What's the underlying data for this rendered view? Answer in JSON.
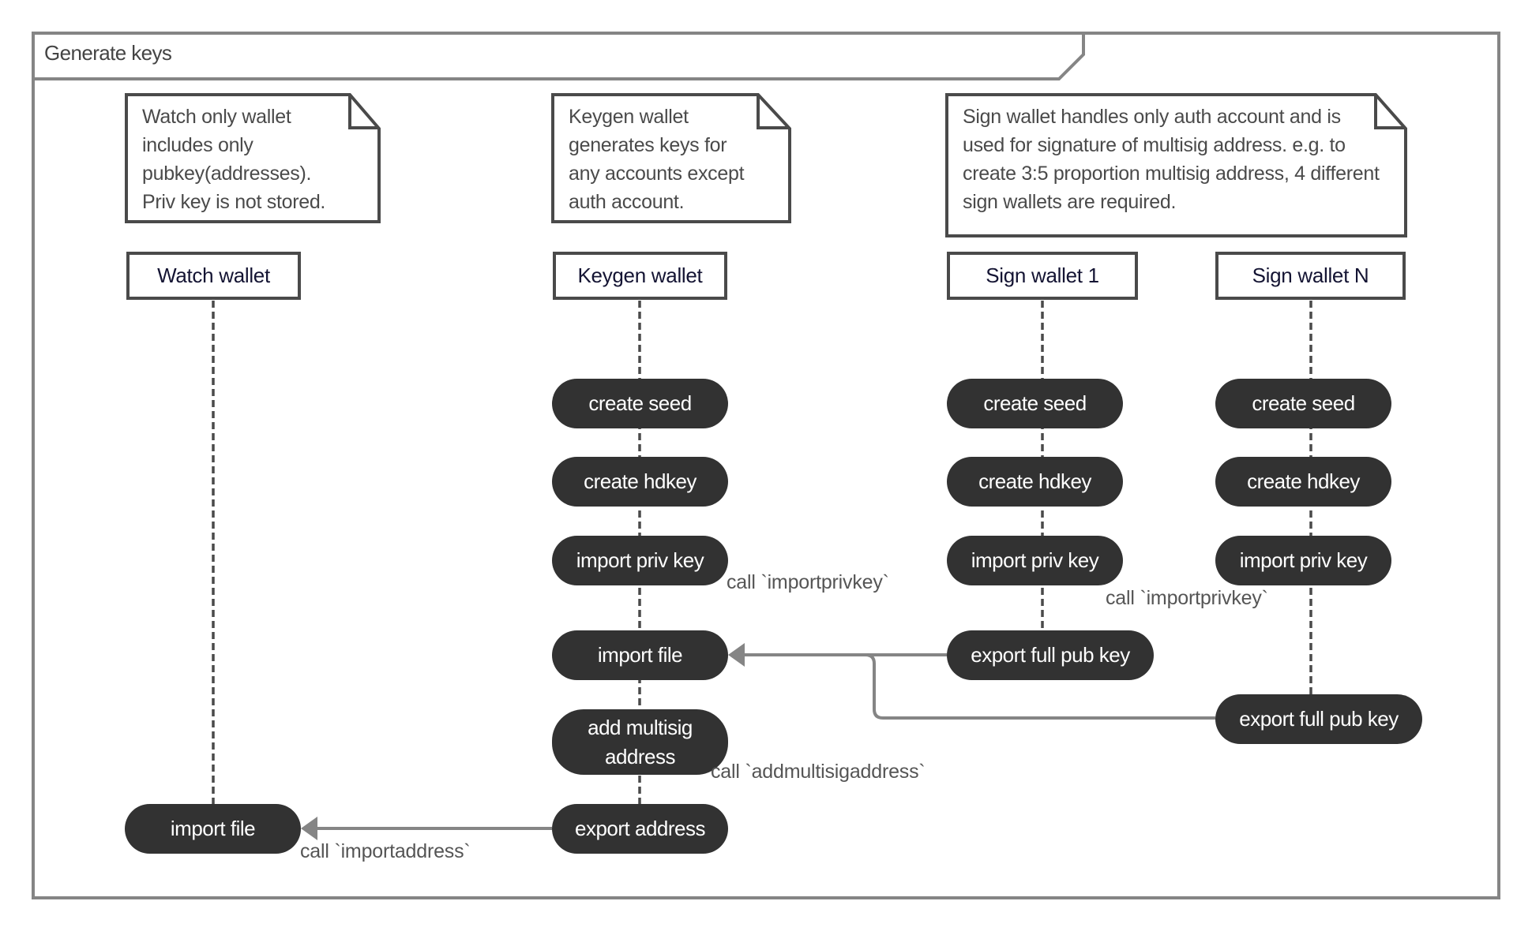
{
  "frame": {
    "title": "Generate keys"
  },
  "notes": {
    "watch": "Watch only wallet includes  only pubkey(addresses). Priv key is not stored.",
    "keygen": "Keygen wallet generates keys for any accounts except auth account.",
    "sign": "Sign wallet handles only auth account and is used for signature of multisig address. e.g. to create 3:5 proportion multisig address, 4 different sign wallets are required."
  },
  "lifelines": {
    "watch": {
      "label": "Watch wallet",
      "steps": {
        "import_file": "import file"
      }
    },
    "keygen": {
      "label": "Keygen wallet",
      "steps": {
        "create_seed": "create seed",
        "create_hdkey": "create hdkey",
        "import_priv_key": "import priv key",
        "import_file": "import file",
        "add_multisig": "add multisig address",
        "export_address": "export address"
      }
    },
    "sign1": {
      "label": "Sign wallet 1",
      "steps": {
        "create_seed": "create seed",
        "create_hdkey": "create hdkey",
        "import_priv_key": "import priv key",
        "export_full_pub_key": "export full pub key"
      }
    },
    "signN": {
      "label": "Sign wallet N",
      "steps": {
        "create_seed": "create seed",
        "create_hdkey": "create hdkey",
        "import_priv_key": "import priv key",
        "export_full_pub_key": "export full pub key"
      }
    }
  },
  "calls": {
    "keygen_importprivkey": "call `importprivkey`",
    "sign_importprivkey": "call `importprivkey`",
    "addmultisigaddress": "call `addmultisigaddress`",
    "importaddress": "call `importaddress`"
  },
  "colors": {
    "frame": "#858585",
    "pill": "#323232",
    "arrow": "#858585",
    "note_border": "#4a4a4a",
    "header_text": "#141433"
  }
}
